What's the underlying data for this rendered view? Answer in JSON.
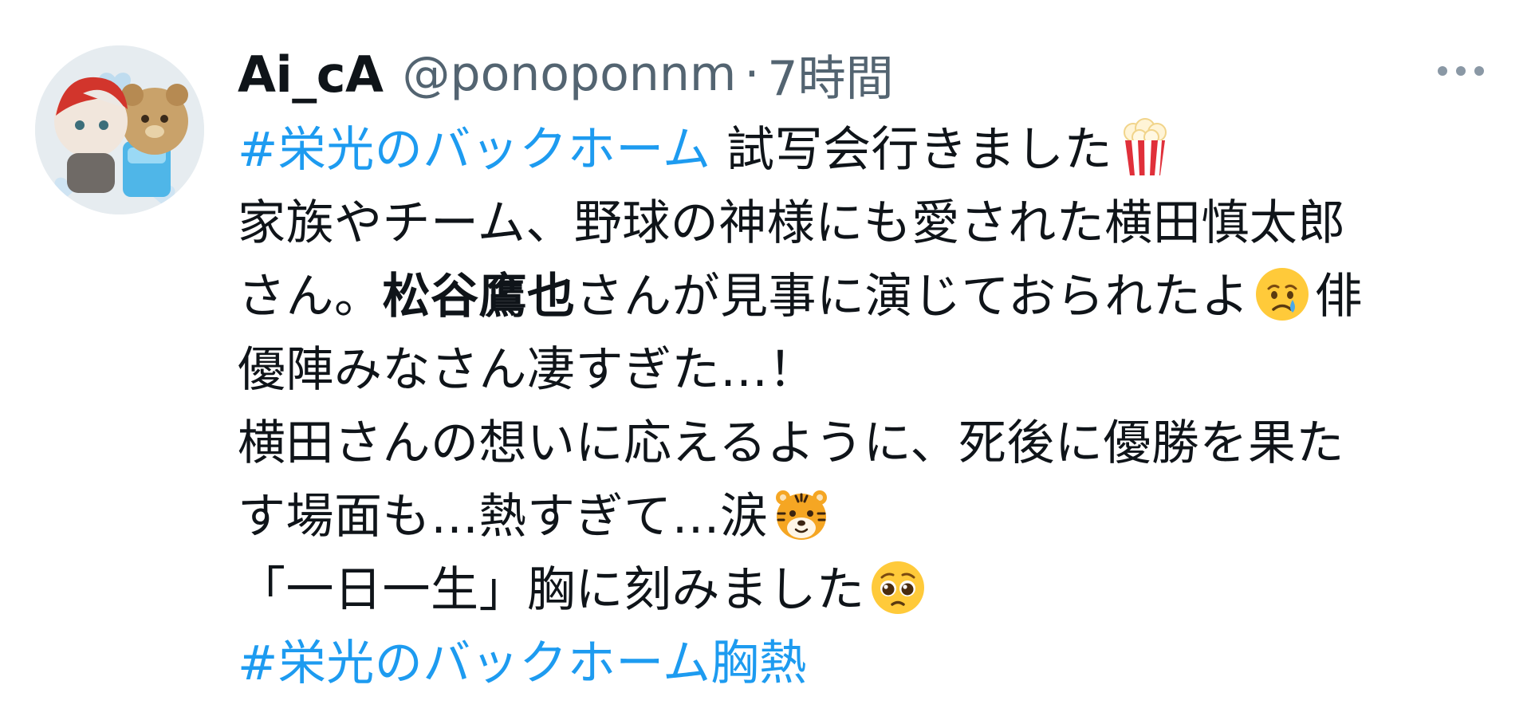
{
  "author": {
    "display_name": "Ai_cA",
    "handle": "@ponoponnm",
    "separator": "·",
    "timestamp": "7時間",
    "avatar_icon": "avatar-plush-toys"
  },
  "more_icon": "more-horizontal-icon",
  "colors": {
    "hashtag": "#1d9bf0",
    "secondary_text": "#536471",
    "primary_text": "#0f1419"
  },
  "tweet": {
    "line1": {
      "hashtag": "#栄光のバックホーム",
      "text": " 試写会行きました",
      "emoji": "popcorn-emoji"
    },
    "line2": {
      "text": "家族やチーム、野球の神様にも愛された横田慎太郎"
    },
    "line3": {
      "text_before": "さん。",
      "bold": "松谷鷹也",
      "text_after": "さんが見事に演じておられたよ",
      "emoji": "crying-face-emoji",
      "text_end": "俳"
    },
    "line4": {
      "text": "優陣みなさん凄すぎた…！"
    },
    "line5": {
      "text": "横田さんの想いに応えるように、死後に優勝を果た"
    },
    "line6": {
      "text": "す場面も…熱すぎて…涙",
      "emoji": "tiger-face-emoji"
    },
    "line7": {
      "text": "「一日一生」胸に刻みました",
      "emoji": "pleading-face-emoji"
    },
    "line8": {
      "hashtag": "#栄光のバックホーム胸熱"
    }
  }
}
